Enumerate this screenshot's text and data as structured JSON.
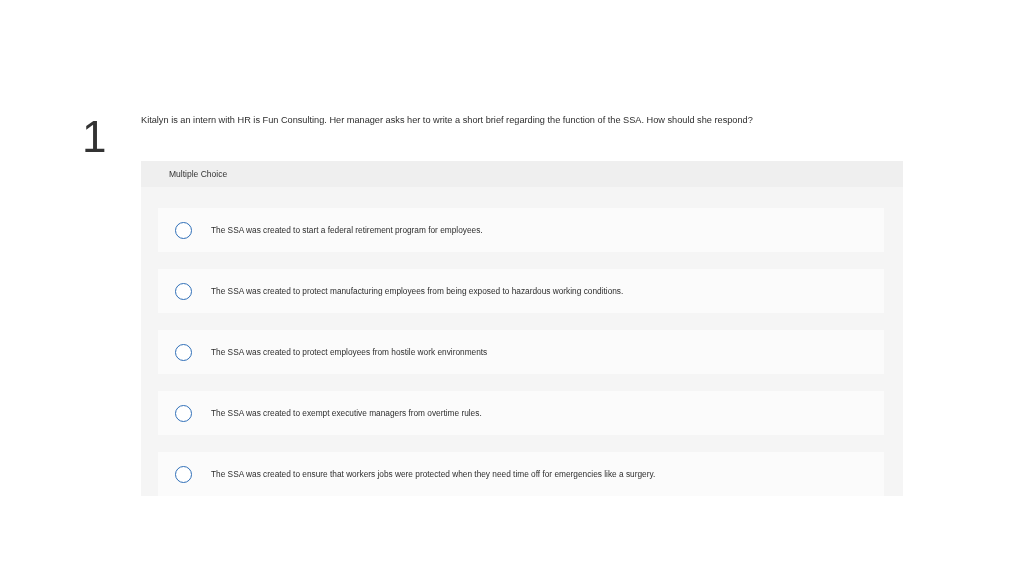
{
  "question": {
    "number": "1",
    "text": "Kitalyn is an intern with HR is Fun Consulting. Her manager asks her to write a short brief regarding the function of the SSA. How should she respond?"
  },
  "answer_panel": {
    "type_label": "Multiple Choice",
    "options": [
      {
        "text": "The SSA was created to start a federal retirement program for employees.",
        "selected": false
      },
      {
        "text": "The SSA was created to protect manufacturing employees from being exposed to hazardous working conditions.",
        "selected": false
      },
      {
        "text": "The SSA was created to protect employees from hostile work environments",
        "selected": false
      },
      {
        "text": "The SSA was created to exempt executive managers from overtime rules.",
        "selected": false
      },
      {
        "text": "The SSA was created to ensure that workers jobs were protected when they need time off for emergencies like a surgery.",
        "selected": false
      }
    ]
  }
}
